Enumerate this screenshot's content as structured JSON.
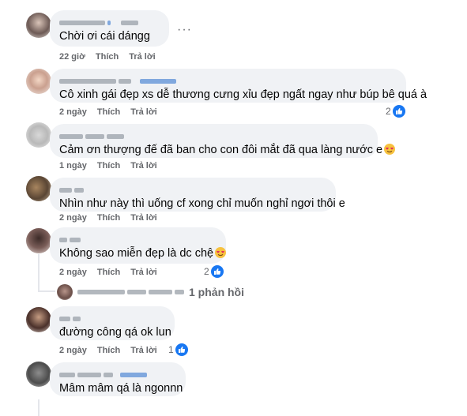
{
  "comments": [
    {
      "text": "Chời ơi cái dángg",
      "time": "22 giờ",
      "like": "Thích",
      "reply": "Trả lời",
      "more": "···"
    },
    {
      "text": "Cô xinh gái đẹp xs dễ thương cưng xỉu đẹp ngất ngay như búp bê quá à",
      "time": "2 ngày",
      "like": "Thích",
      "reply": "Trả lời",
      "reactions": "2"
    },
    {
      "text": "Cảm ơn thượng đế đã ban cho con đôi mắt đã qua làng nước e",
      "time": "1 ngày",
      "like": "Thích",
      "reply": "Trả lời",
      "emoji": "heart-eyes"
    },
    {
      "text": "Nhìn như này thì uống cf xong chỉ muốn nghỉ ngơi thôi e",
      "time": "2 ngày",
      "like": "Thích",
      "reply": "Trả lời"
    },
    {
      "text": "Không sao miễn đẹp là dc chệ",
      "time": "2 ngày",
      "like": "Thích",
      "reply": "Trả lời",
      "reactions": "2",
      "emoji": "heart-eyes",
      "replies_label": "1 phản hồi"
    },
    {
      "text": "đường công qá ok lun",
      "time": "2 ngày",
      "like": "Thích",
      "reply": "Trả lời",
      "reactions": "1"
    },
    {
      "text": "Mâm mâm qá là ngonnn"
    }
  ],
  "colors": {
    "bubble": "#f0f2f5",
    "meta": "#65676b",
    "like_blue": "#1877f2",
    "text": "#050505"
  }
}
